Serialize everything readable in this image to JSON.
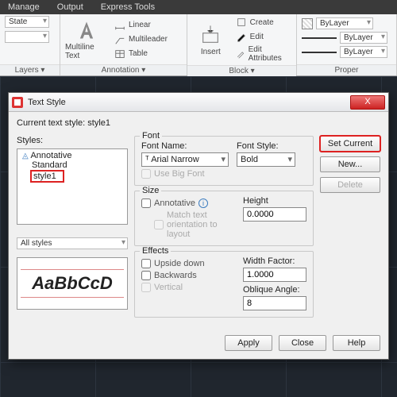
{
  "ribbon": {
    "tabs": [
      "Manage",
      "Output",
      "Express Tools"
    ],
    "layersPanel": {
      "stateLabel": "State",
      "layersLabel": "Layers",
      "title": ""
    },
    "annotationPanel": {
      "multiline": "Multiline Text",
      "items": [
        "Linear",
        "Multileader",
        "Table"
      ],
      "title": "Annotation"
    },
    "blockPanel": {
      "insert": "Insert",
      "items": [
        "Create",
        "Edit",
        "Edit Attributes"
      ],
      "title": "Block"
    },
    "propsPanel": {
      "bylayer": "ByLayer",
      "title": "Proper"
    }
  },
  "dialog": {
    "title": "Text Style",
    "currentLabel": "Current text style:",
    "currentValue": "style1",
    "stylesLabel": "Styles:",
    "styles": {
      "annotative": "Annotative",
      "standard": "Standard",
      "selected": "style1"
    },
    "filterLabel": "All styles",
    "previewText": "AaBbCcD",
    "font": {
      "legend": "Font",
      "nameLabel": "Font Name:",
      "nameValue": "Arial Narrow",
      "styleLabel": "Font Style:",
      "styleValue": "Bold",
      "useBigFont": "Use Big Font"
    },
    "size": {
      "legend": "Size",
      "annotative": "Annotative",
      "match": "Match text orientation to layout",
      "heightLabel": "Height",
      "heightValue": "0.0000"
    },
    "effects": {
      "legend": "Effects",
      "upside": "Upside down",
      "backwards": "Backwards",
      "vertical": "Vertical",
      "widthLabel": "Width Factor:",
      "widthValue": "1.0000",
      "obliqueLabel": "Oblique Angle:",
      "obliqueValue": "8"
    },
    "buttons": {
      "setCurrent": "Set Current",
      "new": "New...",
      "delete": "Delete",
      "apply": "Apply",
      "close": "Close",
      "help": "Help"
    }
  }
}
